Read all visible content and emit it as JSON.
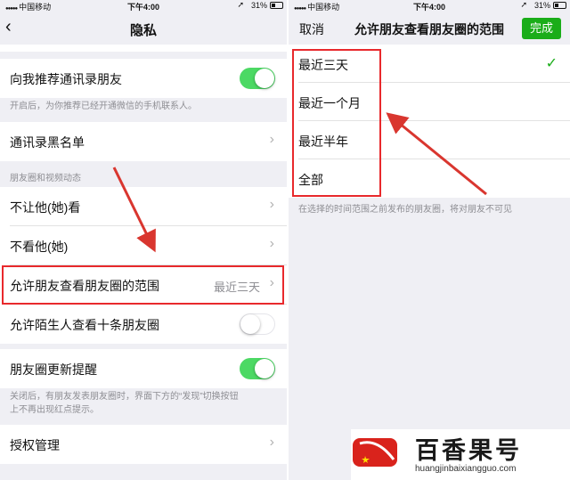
{
  "left": {
    "status": {
      "carrier": "中国移动",
      "time": "下午4:00",
      "battery": "31%"
    },
    "nav": {
      "title": "隐私"
    },
    "rows": {
      "recommend_contacts": {
        "label": "向我推荐通讯录朋友",
        "toggle": "on"
      },
      "recommend_hint": "开启后，为你推荐已经开通微信的手机联系人。",
      "blacklist": {
        "label": "通讯录黑名单"
      },
      "moments_section_header": "朋友圈和视频动态",
      "hide_my_moments": {
        "label": "不让他(她)看"
      },
      "hide_their_moments": {
        "label": "不看他(她)"
      },
      "moments_range": {
        "label": "允许朋友查看朋友圈的范围",
        "value": "最近三天"
      },
      "stranger_ten_posts": {
        "label": "允许陌生人查看十条朋友圈",
        "toggle": "off"
      },
      "moments_update_reminder": {
        "label": "朋友圈更新提醒",
        "toggle": "on"
      },
      "reminder_hint_line1": "关闭后，有朋友发表朋友圈时，界面下方的“发现”切换按钮",
      "reminder_hint_line2": "上不再出现红点提示。",
      "authorization": {
        "label": "授权管理"
      }
    }
  },
  "right": {
    "status": {
      "carrier": "中国移动",
      "time": "下午4:00",
      "battery": "31%"
    },
    "nav": {
      "cancel": "取消",
      "title": "允许朋友查看朋友圈的范围",
      "done": "完成"
    },
    "options": [
      "最近三天",
      "最近一个月",
      "最近半年",
      "全部"
    ],
    "selected_index": 0,
    "footer_hint": "在选择的时间范围之前发布的朋友圈，将对朋友不可见"
  },
  "watermark": {
    "title": "百香果号",
    "url": "huangjinbaixiangguo.com"
  },
  "colors": {
    "switch_on": "#4cd964",
    "done_button": "#1aad19",
    "annotation_red": "#e8292c"
  }
}
